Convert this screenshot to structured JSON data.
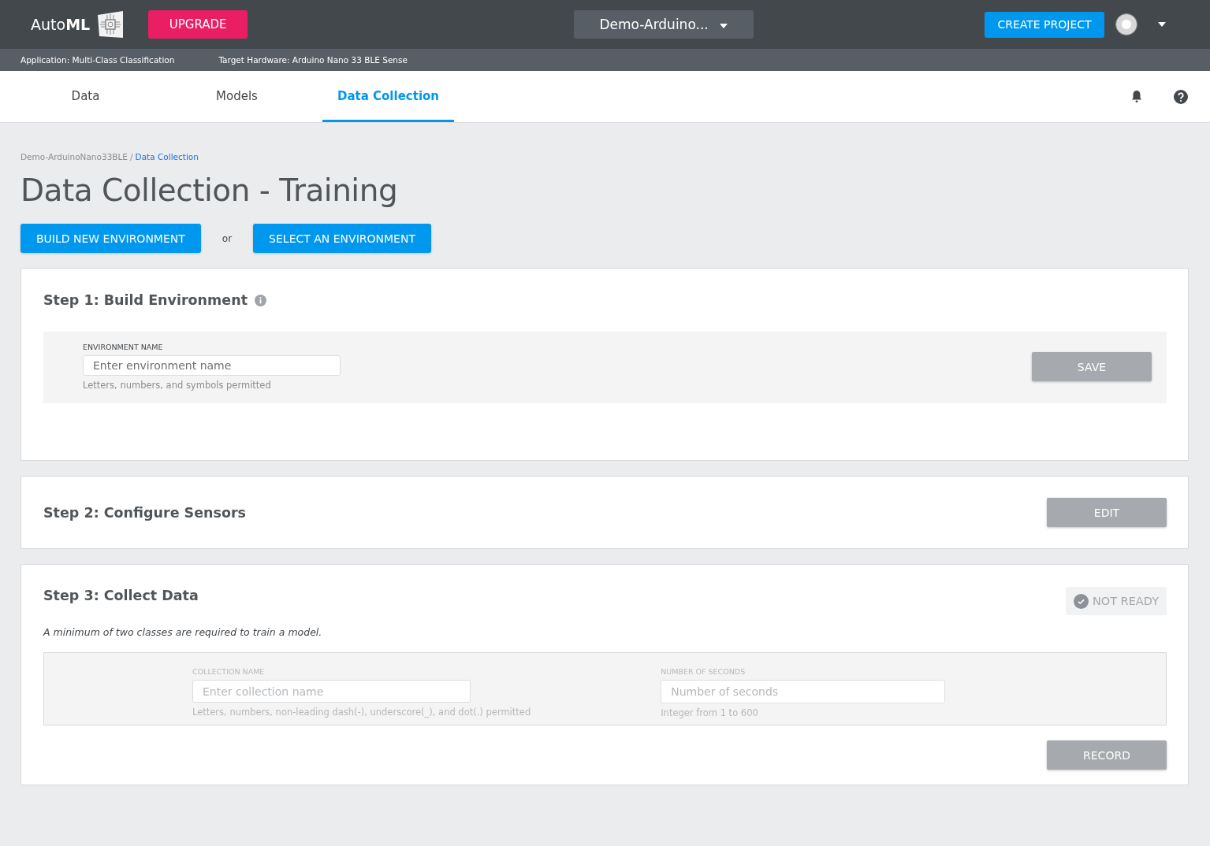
{
  "header": {
    "logo_text": "Auto",
    "logo_bold": "ML",
    "upgrade_button": "UPGRADE",
    "project_selector": "Demo-Arduino...",
    "create_button": "CREATE PROJECT"
  },
  "info_bar": [
    "Application: Multi-Class Classification",
    "Target Hardware: Arduino Nano 33 BLE Sense"
  ],
  "tabs": [
    {
      "label": "Data",
      "selected": false
    },
    {
      "label": "Models",
      "selected": false
    },
    {
      "label": "Data Collection",
      "selected": true
    }
  ],
  "breadcrumb": {
    "parent": "Demo-ArduinoNano33BLE",
    "separator": "/",
    "current": "Data Collection"
  },
  "title": "Data Collection - Training",
  "actions": {
    "primary": "BUILD NEW ENVIRONMENT",
    "or": "or",
    "secondary": "SELECT AN ENVIRONMENT"
  },
  "steps": [
    {
      "kind": "form",
      "title": "Step 1: Build Environment",
      "fields": [
        {
          "label": "ENVIRONMENT NAME",
          "placeholder": "Enter environment name",
          "hint": "Letters, numbers, and symbols permitted",
          "disabled": false
        }
      ],
      "button": {
        "label": "SAVE",
        "disabled": true
      }
    },
    {
      "kind": "header",
      "title": "Step 2: Configure Sensors",
      "button": {
        "label": "EDIT",
        "disabled": true
      }
    },
    {
      "kind": "collect",
      "title": "Step 3: Collect Data",
      "status": "NOT READY",
      "note": "A minimum of two classes are required to train a model.",
      "fields": [
        {
          "label": "COLLECTION NAME",
          "placeholder": "Enter collection name",
          "hint": "Letters, numbers, non-leading dash(-), underscore(_), and dot(.) permitted",
          "disabled": true
        },
        {
          "label": "NUMBER OF SECONDS",
          "placeholder": "Number of seconds",
          "hint": "Integer from 1 to 600",
          "disabled": true
        }
      ],
      "button": {
        "label": "RECORD",
        "disabled": true
      }
    }
  ]
}
